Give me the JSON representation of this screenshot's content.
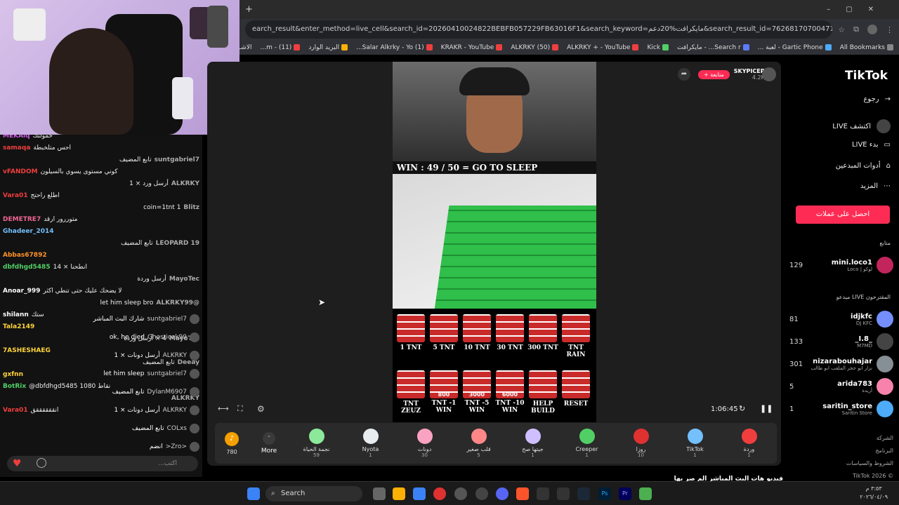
{
  "browser": {
    "url": "earch_result&enter_method=live_cell&search_id=20260410024822BEBFB057229FB63016F1&search_keyword=مايكرافت%20دعم&search_result_id=7626817070047103762&search_type=...",
    "bookmarks": [
      "الاشـ",
      "(11) - m...",
      "البريد الوارد",
      "(1) Salar Alkrky - Yo...",
      "KRAKR - YouTube",
      "(50) ALKRKY",
      "ALKRKY + - YouTube",
      "Kick",
      "Search r... - مايكرافت",
      "Gartic Phone - لعبة ...",
      "All Bookmarks"
    ]
  },
  "chat": {
    "messages": [
      {
        "user": "MEKAlq",
        "text": "حمولتك",
        "color": "#cc5de8"
      },
      {
        "user": "samaqa",
        "text": "احس متلخبطة",
        "color": "#f03e3e"
      },
      {
        "user": "suntgabriel7",
        "text": "تابع المضيف",
        "color": "#aaa",
        "rtl": true
      },
      {
        "user": "vFANDOM",
        "text": "كوني مستوى يسوي بالسيلون",
        "color": "#f03e3e"
      },
      {
        "user": "ALKRKY",
        "text": "أرسل ورد × 1",
        "color": "#aaa",
        "rtl": true
      },
      {
        "user": "Vara01",
        "text": "اطلع راحتج",
        "color": "#f03e3e"
      },
      {
        "user": "Blitz",
        "text": "coin=1tnt 1",
        "color": "#aaa",
        "rtl": true
      },
      {
        "user": "DEMETRE7",
        "text": "متوررور ارقد",
        "color": "#f06595"
      },
      {
        "user": "Ghadeer_2014",
        "text": "",
        "color": "#74c0fc"
      },
      {
        "user": "LEOPARD 19",
        "text": "تابع المضيف",
        "color": "#aaa",
        "rtl": true
      },
      {
        "user": "Abbas67892",
        "text": "",
        "color": "#ff922b"
      },
      {
        "user": "dbfdhgd5485",
        "text": "14 × انطحنا",
        "color": "#51cf66"
      },
      {
        "user": "MayoTec",
        "text": "أرسل وردة",
        "color": "#aaa",
        "rtl": true
      },
      {
        "user": "Anoar_999",
        "text": "لا يضحك عليك حتى تنطي اكثر",
        "color": "#fff"
      },
      {
        "user": "@ALKRKY99",
        "text": "let him sleep bro",
        "color": "#aaa",
        "rtl": true
      },
      {
        "user": "shilann",
        "text": "ستك",
        "color": "#fff"
      },
      {
        "user": "Tala2149",
        "text": "",
        "color": "#ffd43b"
      },
      {
        "user": "MayoTec",
        "text": "4 × أرسل وردة",
        "color": "#aaa",
        "rtl": true
      },
      {
        "user": "7ASHESHAEG",
        "text": "",
        "color": "#ffd43b"
      },
      {
        "user": "Deeay",
        "text": "تابع المضيف",
        "color": "#aaa",
        "rtl": true
      },
      {
        "user": "gxfnn",
        "text": "",
        "color": "#ffd43b"
      },
      {
        "user": "BotRix",
        "text": "@dbfdhgd5485 نقاط 1080",
        "color": "#51cf66"
      },
      {
        "user": "ALKRKY",
        "text": "",
        "color": "#aaa",
        "rtl": true
      },
      {
        "user": "Vara01",
        "text": "انققققققق",
        "color": "#f03e3e"
      }
    ],
    "live_rows": [
      {
        "user": "suntgabriel7",
        "text": "شارك البث المباشر"
      },
      {
        "user": "Ghosticek99",
        "text": "ok, he died"
      },
      {
        "user": "ALKRKY",
        "text": "أرسل دونات × 1"
      },
      {
        "user": "suntgabriel7",
        "text": "let him sleep"
      },
      {
        "user": "DylanM6907",
        "text": "تابع المضيف"
      },
      {
        "user": "ALKRKY",
        "text": "أرسل دونات × 1"
      },
      {
        "user": "COLxs",
        "text": "تابع المضيف"
      },
      {
        "user": "<Zro<",
        "text": "انضم"
      }
    ],
    "input_placeholder": "اكتب..."
  },
  "stream": {
    "streamer": "SKYPICER",
    "followers": "4.2K",
    "follow_label": "+ متابعة",
    "banner": "WIN : 49 / 50 = GO TO SLEEP",
    "time": "1:06:45",
    "tnt": [
      {
        "label": "1 TNT"
      },
      {
        "label": "5 TNT"
      },
      {
        "label": "10 TNT"
      },
      {
        "label": "30 TNT"
      },
      {
        "label": "300 TNT"
      },
      {
        "label": "TNT RAIN"
      },
      {
        "label": "TNT ZEUZ"
      },
      {
        "label": "TNT -1 WIN",
        "value": "800"
      },
      {
        "label": "TNT -5 WIN",
        "value": "3000"
      },
      {
        "label": "TNT -10 WIN",
        "value": "6000"
      },
      {
        "label": "HELP BUILD"
      },
      {
        "label": "RESET"
      }
    ]
  },
  "gifts": {
    "coins": "780",
    "more_label": "More",
    "items": [
      {
        "name": "نجمة الحياة",
        "price": "59",
        "color": "#8ce99a"
      },
      {
        "name": "Nyota",
        "price": "1",
        "color": "#e9ecef"
      },
      {
        "name": "دونات",
        "price": "30",
        "color": "#faa2c1"
      },
      {
        "name": "قلب صغير",
        "price": "5",
        "color": "#ff8787"
      },
      {
        "name": "جيتها صح",
        "price": "1",
        "color": "#d0bfff"
      },
      {
        "name": "Creeper",
        "price": "1",
        "color": "#51cf66"
      },
      {
        "name": "روزا",
        "price": "10",
        "color": "#e03131"
      },
      {
        "name": "TikTok",
        "price": "1",
        "color": "#74c0fc"
      },
      {
        "name": "وردة",
        "price": "1",
        "color": "#f03e3e"
      }
    ]
  },
  "sidebar": {
    "brand": "TikTok",
    "nav": [
      "رجوع",
      "اكتشف LIVE",
      "بدء LIVE",
      "أدوات المبدعين",
      "المزيد"
    ],
    "coins_button": "احصل على عملات",
    "following_title": "متابع",
    "following": [
      {
        "name": "mini.loco1",
        "sub": "Loco | لوكو",
        "count": "129"
      }
    ],
    "suggested_title": "ميدعو LIVE المقترحون",
    "suggested": [
      {
        "name": "idjkfc",
        "sub": "DJ KFC",
        "count": "81",
        "color": "#748ffc"
      },
      {
        "name": "_I.8_",
        "sub": "M7MD",
        "count": "133",
        "color": "#444"
      },
      {
        "name": "nizarabouhajar",
        "sub": "نزار ابو حجر الملقب ابو طالب",
        "count": "301",
        "color": "#868e96"
      },
      {
        "name": "arida783",
        "sub": "أريدة",
        "count": "5",
        "color": "#f783ac"
      },
      {
        "name": "saritin_store",
        "sub": "Saritin Store",
        "count": "1",
        "color": "#4dabf7"
      }
    ],
    "footer": [
      "الشركة",
      "البرنامج",
      "الشروط والسياسات",
      "TikTok 2026 ©"
    ]
  },
  "taskbar": {
    "search_label": "Search",
    "time": "٣:٥٣ م",
    "date": "٢٠٢٦/٠٤/٠٩"
  },
  "subtitle": "فيديو هات البث المباشر   الم صر بها"
}
